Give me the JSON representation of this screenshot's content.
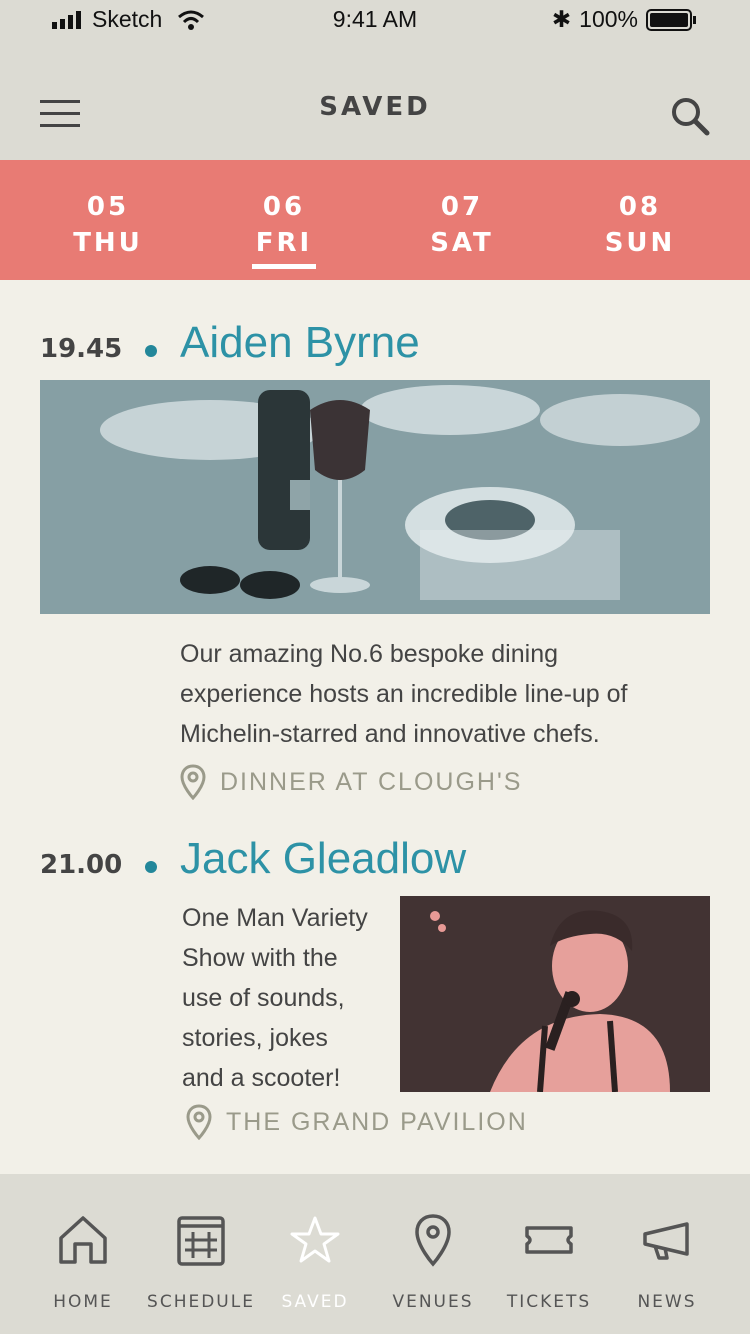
{
  "status": {
    "carrier": "Sketch",
    "time": "9:41 AM",
    "battery": "100%"
  },
  "header": {
    "title": "SAVED"
  },
  "dates": [
    {
      "num": "05",
      "day": "THU",
      "active": false
    },
    {
      "num": "06",
      "day": "FRI",
      "active": true
    },
    {
      "num": "07",
      "day": "SAT",
      "active": false
    },
    {
      "num": "08",
      "day": "SUN",
      "active": false
    }
  ],
  "events": [
    {
      "time": "19.45",
      "title": "Aiden Byrne",
      "description": [
        "Our amazing No.6 bespoke dining",
        "experience hosts an incredible line-up of",
        "Michelin-starred and innovative chefs."
      ],
      "venue": "DINNER AT CLOUGH'S"
    },
    {
      "time": "21.00",
      "title": "Jack Gleadlow",
      "description": [
        "One Man Variety",
        "Show with the",
        "use of sounds,",
        "stories, jokes",
        "and a scooter!"
      ],
      "venue": "THE GRAND PAVILION"
    }
  ],
  "tabs": [
    {
      "label": "HOME",
      "icon": "home-icon"
    },
    {
      "label": "SCHEDULE",
      "icon": "calendar-icon"
    },
    {
      "label": "SAVED",
      "icon": "star-icon"
    },
    {
      "label": "VENUES",
      "icon": "location-pin-icon"
    },
    {
      "label": "TICKETS",
      "icon": "ticket-icon"
    },
    {
      "label": "NEWS",
      "icon": "megaphone-icon"
    }
  ],
  "colors": {
    "accent": "#e87b74",
    "title": "#2d92a6",
    "background": "#f2f0e8",
    "bar": "#dcdbd3"
  }
}
